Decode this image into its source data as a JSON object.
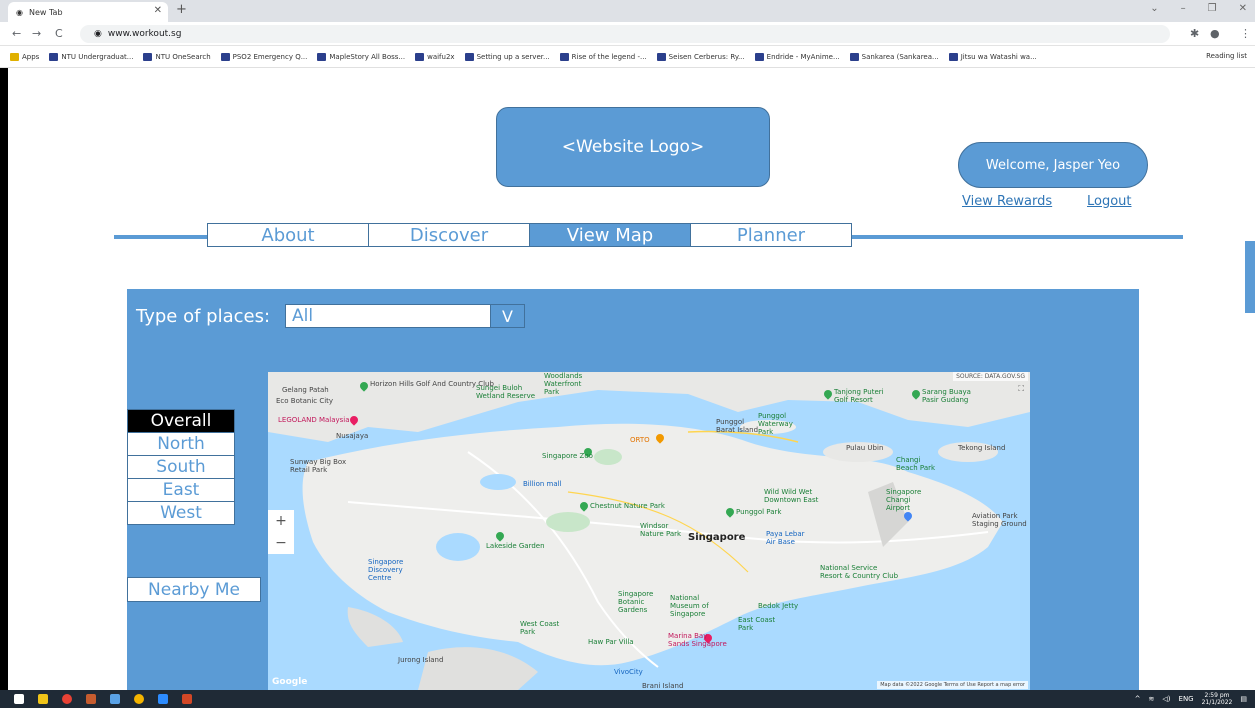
{
  "browser": {
    "tab_title": "New Tab",
    "url": "www.workout.sg",
    "bookmarks": [
      "Apps",
      "NTU Undergraduat...",
      "NTU OneSearch",
      "PSO2 Emergency Q...",
      "MapleStory All Boss...",
      "waifu2x",
      "Setting up a server...",
      "Rise of the legend -...",
      "Seisen Cerberus: Ry...",
      "Endride - MyAnime...",
      "Sankarea (Sankarea...",
      "Jitsu wa Watashi wa..."
    ],
    "reading_list": "Reading list"
  },
  "header": {
    "logo": "<Website Logo>",
    "welcome": "Welcome, Jasper Yeo",
    "view_rewards": "View Rewards",
    "logout": "Logout"
  },
  "nav": [
    "About",
    "Discover",
    "View Map",
    "Planner"
  ],
  "nav_active": "View Map",
  "filter": {
    "label": "Type of places:",
    "value": "All",
    "arrow": "V"
  },
  "regions": [
    "Overall",
    "North",
    "South",
    "East",
    "West"
  ],
  "region_active": "Overall",
  "nearby": "Nearby Me",
  "map": {
    "source": "SOURCE: DATA.GOV.SG",
    "attribution": "Map data ©2022 Google   Terms of Use   Report a map error",
    "brand": "Google",
    "zoom_in": "+",
    "zoom_out": "−",
    "labels": {
      "gelang": "Gelang Patah",
      "eco": "Eco Botanic City",
      "legoland": "LEGOLAND Malaysia",
      "nusajaya": "Nusajaya",
      "sunway": "Sunway Big Box Retail Park",
      "horizon": "Horizon Hills Golf And Country Club",
      "buloh": "Sungei Buloh Wetland Reserve",
      "woodlands": "Woodlands Waterfront Park",
      "zoo": "Singapore Zoo",
      "orto": "ORTO",
      "punggol_wp": "Punggol Waterway Park",
      "punggol_island": "Punggol Barat Island",
      "tanjong": "Tanjong Puteri Golf Resort",
      "sarang": "Sarang Buaya Pasir Gudang",
      "ubin": "Pulau Ubin",
      "tekong": "Tekong Island",
      "changi_beach": "Changi Beach Park",
      "changi_airport": "Singapore Changi Airport",
      "aviation": "Aviation Park Staging Ground",
      "chestnut": "Chestnut Nature Park",
      "windsor": "Windsor Nature Park",
      "punggol_park": "Punggol Park",
      "wildwild": "Wild Wild Wet Downtown East",
      "singapore": "Singapore",
      "paya": "Paya Lebar Air Base",
      "lakeside": "Lakeside Garden",
      "discovery": "Singapore Discovery Centre",
      "nsrcc": "National Service Resort & Country Club",
      "botanic": "Singapore Botanic Gardens",
      "museum": "National Museum of Singapore",
      "bedok": "Bedok Jetty",
      "eastcoast": "East Coast Park",
      "westcoast": "West Coast Park",
      "hawpar": "Haw Par Villa",
      "marina": "Marina Bay Sands Singapore",
      "vivocity": "VivoCity",
      "jurong": "Jurong Island",
      "brani": "Brani Island",
      "billion": "Billion mall"
    }
  },
  "taskbar": {
    "lang": "ENG",
    "time": "2:59 pm",
    "date": "21/1/2022"
  },
  "colors": {
    "accent": "#5b9bd5",
    "border": "#41719c",
    "link": "#2e75b6"
  }
}
